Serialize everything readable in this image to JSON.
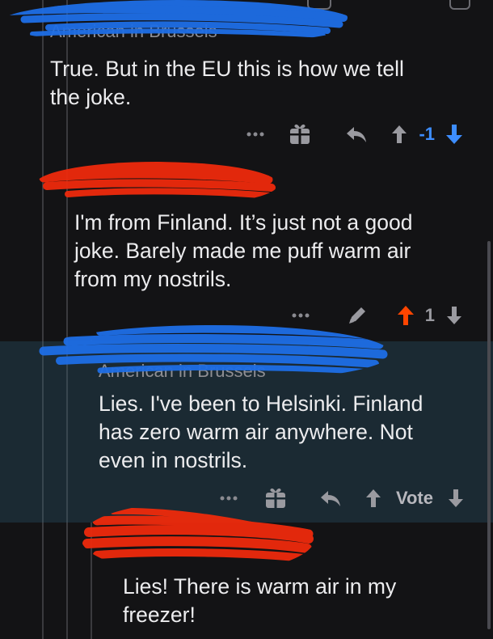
{
  "comments": [
    {
      "author": "American in Brussels",
      "body_lines": [
        "True. But in the EU this is how we tell",
        "the joke."
      ],
      "actions": {
        "more_icon": "more-dots-icon",
        "gift_icon": "gift-icon",
        "reply_icon": "reply-arrow-icon",
        "upvote_icon": "upvote-arrow-icon",
        "vote_count": "-1",
        "downvote_icon": "downvote-arrow-icon",
        "downvote_state": "active"
      }
    },
    {
      "author": "",
      "body_lines": [
        "I'm from Finland. It’s just not a good",
        "joke. Barely made me puff warm air",
        "from my nostrils."
      ],
      "actions": {
        "more_icon": "more-dots-icon",
        "edit_icon": "edit-pencil-icon",
        "upvote_icon": "upvote-arrow-icon",
        "vote_count": "1",
        "downvote_icon": "downvote-arrow-icon",
        "upvote_state": "active"
      }
    },
    {
      "author": "American in Brussels",
      "body_lines": [
        "Lies. I've been to Helsinki. Finland",
        "has zero warm air anywhere. Not",
        "even in nostrils."
      ],
      "highlighted": true,
      "actions": {
        "more_icon": "more-dots-icon",
        "gift_icon": "gift-icon",
        "reply_icon": "reply-arrow-icon",
        "upvote_icon": "upvote-arrow-icon",
        "vote_label": "Vote",
        "downvote_icon": "downvote-arrow-icon"
      }
    },
    {
      "author": "",
      "body_lines": [
        "Lies! There is warm air in my",
        "freezer!"
      ]
    }
  ],
  "colors": {
    "background": "#131315",
    "highlight": "#1b2a33",
    "upvote_active": "#ff4500",
    "downvote_active": "#3d8dff",
    "icon": "#9a9aa0",
    "redact_blue": "#1e6ee6",
    "redact_red": "#ee2a0c"
  }
}
